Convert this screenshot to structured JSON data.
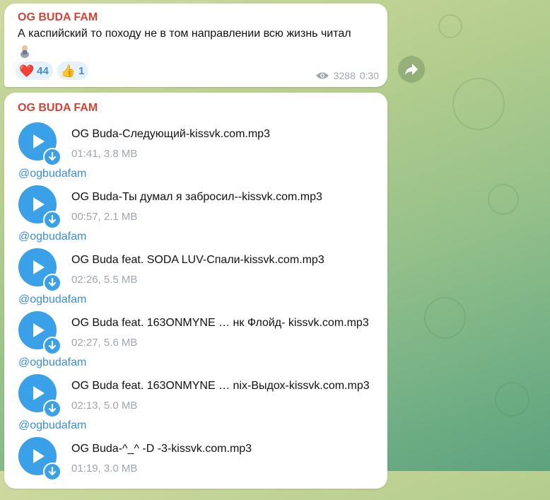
{
  "post1": {
    "sender": "OG BUDA FAM",
    "text": "А каспийский то походу не в том направлении всю жизнь читал",
    "reactions": [
      {
        "emoji": "❤️",
        "count": "44",
        "icon": "red-heart-icon"
      },
      {
        "emoji": "👍",
        "count": "1",
        "icon": "thumbs-up-icon"
      }
    ],
    "views": "3288",
    "time": "0:30"
  },
  "post2": {
    "sender": "OG BUDA FAM",
    "tracks": [
      {
        "title": "OG Buda-Следующий-kissvk.com.mp3",
        "meta": "01:41, 3.8 MB",
        "link": "@ogbudafam"
      },
      {
        "title": "OG Buda-Ты думал я забросил--kissvk.com.mp3",
        "meta": "00:57, 2.1 MB",
        "link": "@ogbudafam"
      },
      {
        "title": "OG Buda feat. SODA LUV-Спали-kissvk.com.mp3",
        "meta": "02:26, 5.5 MB",
        "link": "@ogbudafam"
      },
      {
        "title": "OG Buda feat. 163ONMYNE … нк Флойд- kissvk.com.mp3",
        "meta": "02:27, 5.6 MB",
        "link": "@ogbudafam"
      },
      {
        "title": "OG Buda feat. 163ONMYNE … nix-Выдох-kissvk.com.mp3",
        "meta": "02:13, 5.0 MB",
        "link": "@ogbudafam"
      },
      {
        "title": "OG Buda-^_^ -D -3-kissvk.com.mp3",
        "meta": "01:19, 3.0 MB",
        "link": ""
      }
    ]
  },
  "colors": {
    "sender": "#d0453a",
    "accent": "#3aa1e8",
    "link": "#3a8fd8"
  }
}
